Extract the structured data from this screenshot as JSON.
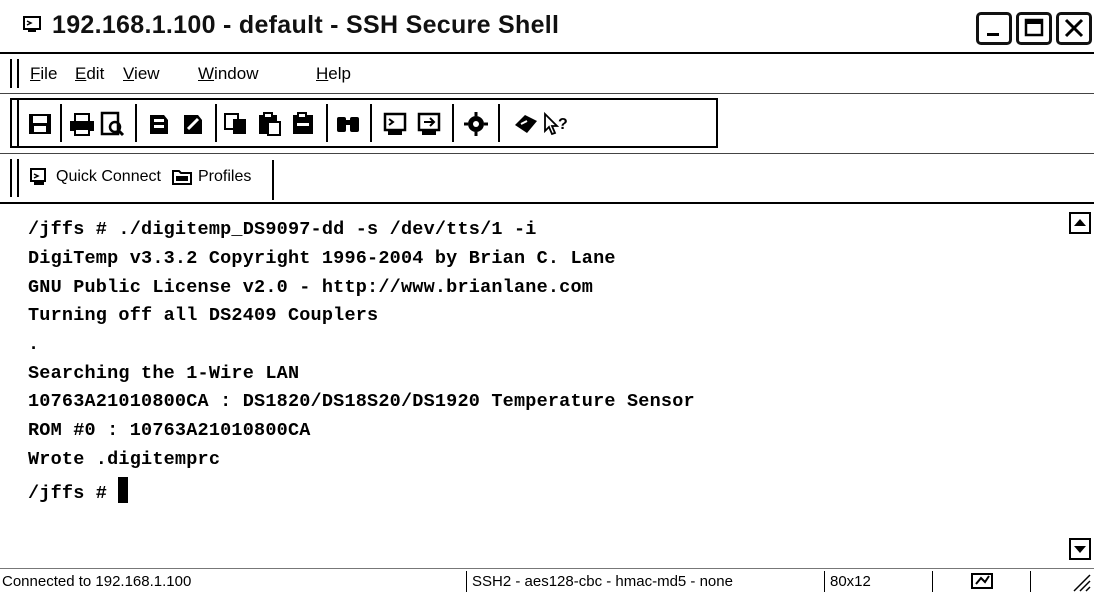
{
  "window": {
    "title": "192.168.1.100 - default - SSH Secure Shell"
  },
  "menu": {
    "items": [
      {
        "label": "File",
        "accel": "F",
        "rest": "ile"
      },
      {
        "label": "Edit",
        "accel": "E",
        "rest": "dit"
      },
      {
        "label": "View",
        "accel": "V",
        "rest": "iew"
      },
      {
        "label": "Window",
        "accel": "W",
        "rest": "indow"
      },
      {
        "label": "Help",
        "accel": "H",
        "rest": "elp"
      }
    ]
  },
  "toolbar": {
    "icons": [
      "save-icon",
      "print-icon",
      "print-preview-icon",
      "key-icon",
      "key-settings-icon",
      "copy-icon",
      "paste-icon",
      "paste-special-icon",
      "find-icon",
      "new-terminal-icon",
      "new-file-transfer-icon",
      "settings-icon",
      "help-icon",
      "context-help-icon"
    ]
  },
  "quickbar": {
    "quick_connect": "Quick Connect",
    "profiles": "Profiles"
  },
  "terminal": {
    "lines": [
      "/jffs # ./digitemp_DS9097-dd -s /dev/tts/1 -i",
      "DigiTemp v3.3.2 Copyright 1996-2004 by Brian C. Lane",
      "GNU Public License v2.0 - http://www.brianlane.com",
      "Turning off all DS2409 Couplers",
      ".",
      "Searching the 1-Wire LAN",
      "10763A21010800CA : DS1820/DS18S20/DS1920 Temperature Sensor",
      "ROM #0 : 10763A21010800CA",
      "Wrote .digitemprc"
    ],
    "prompt": "/jffs # "
  },
  "status": {
    "connection": "Connected to 192.168.1.100",
    "cipher": "SSH2 - aes128-cbc - hmac-md5 - none",
    "size": "80x12"
  }
}
